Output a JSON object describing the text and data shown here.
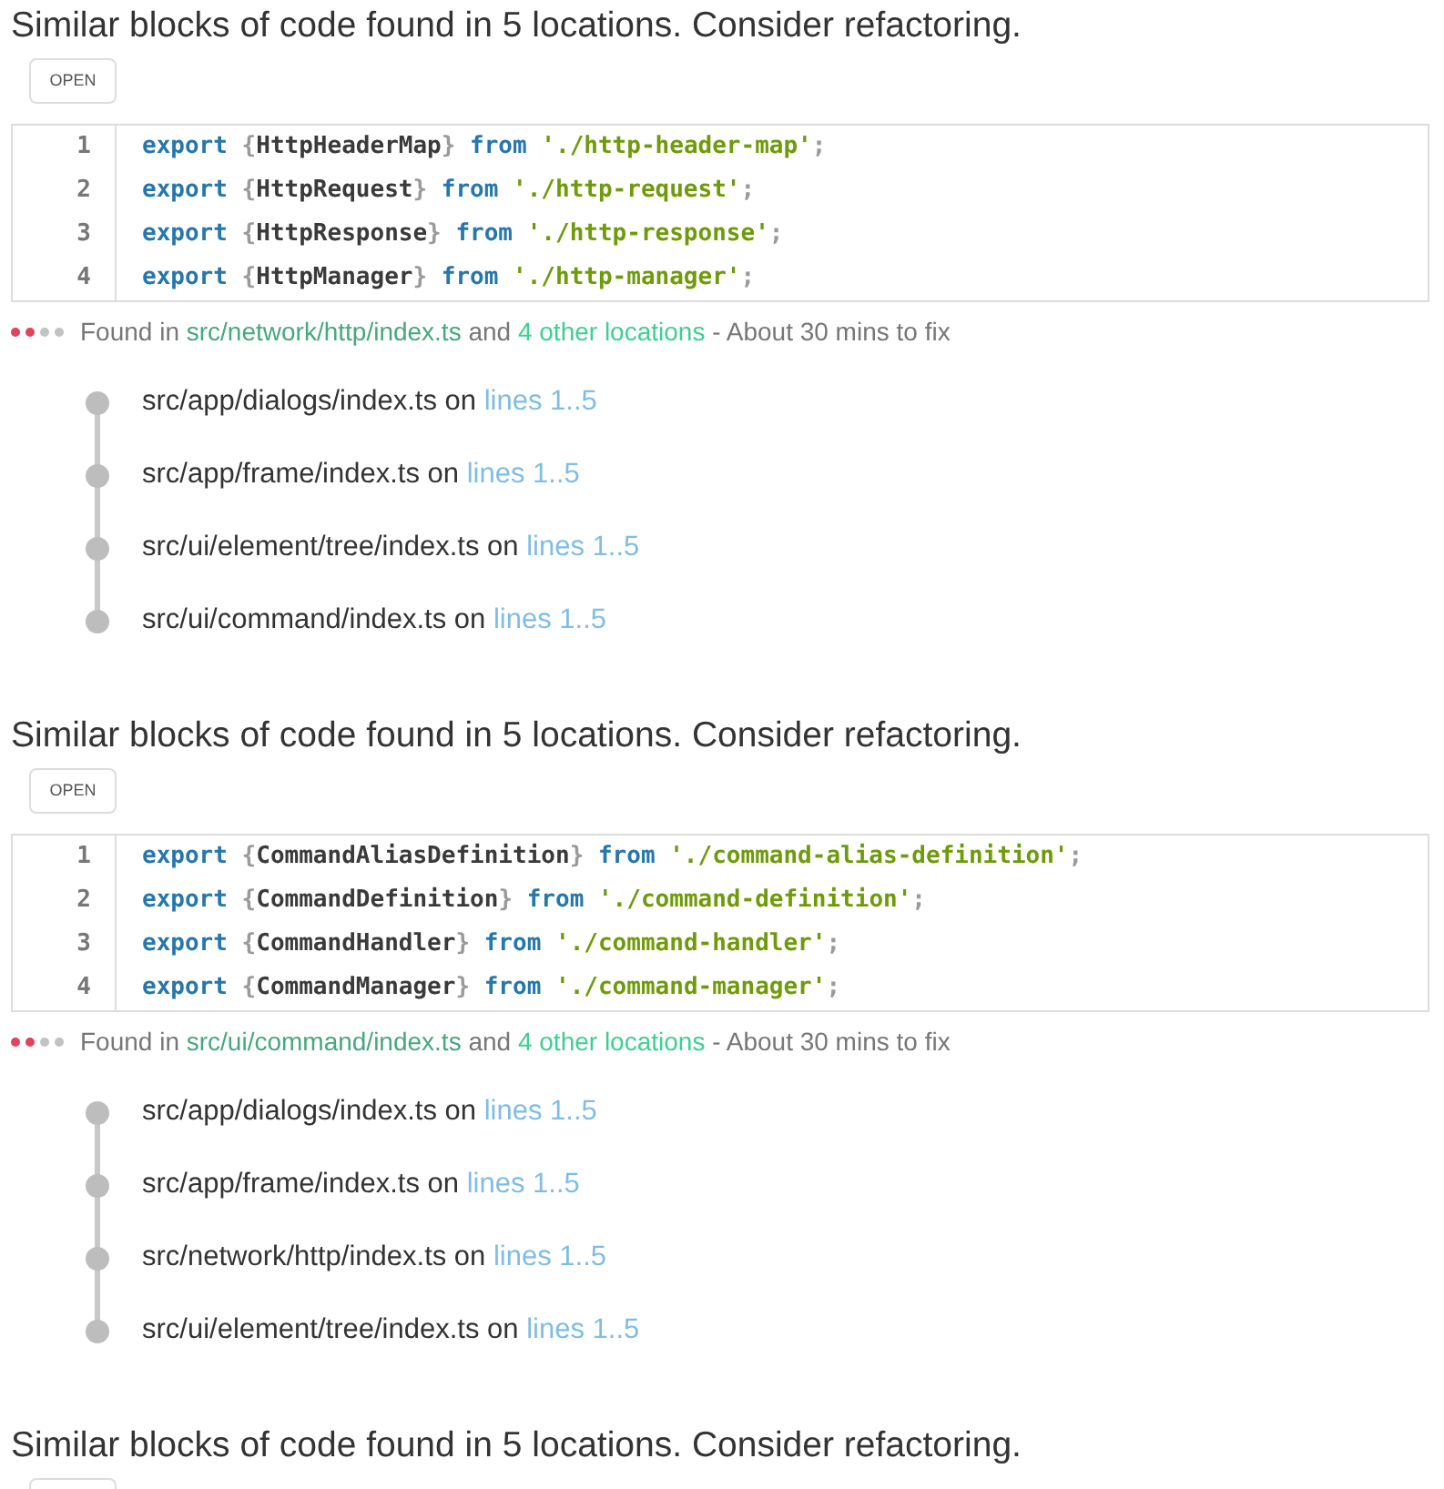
{
  "issues": [
    {
      "title": "Similar blocks of code found in 5 locations. Consider refactoring.",
      "open_button": {
        "label": "OPEN"
      },
      "code": [
        {
          "number": "1",
          "tokens": [
            {
              "kind": "keyword",
              "text": "export"
            },
            {
              "kind": "brace_open",
              "text": "{"
            },
            {
              "kind": "name",
              "text": "HttpHeaderMap"
            },
            {
              "kind": "brace_close",
              "text": "}"
            },
            {
              "kind": "keyword",
              "text": "from"
            },
            {
              "kind": "string",
              "text": "'./http-header-map'"
            },
            {
              "kind": "terminator",
              "text": ";"
            }
          ]
        },
        {
          "number": "2",
          "tokens": [
            {
              "kind": "keyword",
              "text": "export"
            },
            {
              "kind": "brace_open",
              "text": "{"
            },
            {
              "kind": "name",
              "text": "HttpRequest"
            },
            {
              "kind": "brace_close",
              "text": "}"
            },
            {
              "kind": "keyword",
              "text": "from"
            },
            {
              "kind": "string",
              "text": "'./http-request'"
            },
            {
              "kind": "terminator",
              "text": ";"
            }
          ]
        },
        {
          "number": "3",
          "tokens": [
            {
              "kind": "keyword",
              "text": "export"
            },
            {
              "kind": "brace_open",
              "text": "{"
            },
            {
              "kind": "name",
              "text": "HttpResponse"
            },
            {
              "kind": "brace_close",
              "text": "}"
            },
            {
              "kind": "keyword",
              "text": "from"
            },
            {
              "kind": "string",
              "text": "'./http-response'"
            },
            {
              "kind": "terminator",
              "text": ";"
            }
          ]
        },
        {
          "number": "4",
          "tokens": [
            {
              "kind": "keyword",
              "text": "export"
            },
            {
              "kind": "brace_open",
              "text": "{"
            },
            {
              "kind": "name",
              "text": "HttpManager"
            },
            {
              "kind": "brace_close",
              "text": "}"
            },
            {
              "kind": "keyword",
              "text": "from"
            },
            {
              "kind": "string",
              "text": "'./http-manager'"
            },
            {
              "kind": "terminator",
              "text": ";"
            }
          ]
        }
      ],
      "footer": {
        "stars": 2,
        "prefix": "Found in",
        "path": "src/network/http/index.ts",
        "joiner": "and",
        "others": "4 other locations",
        "suffix": "- About 30 mins to fix"
      },
      "locations": [
        {
          "path": "src/app/dialogs/index.ts",
          "joiner": "on",
          "lines": "lines 1..5"
        },
        {
          "path": "src/app/frame/index.ts",
          "joiner": "on",
          "lines": "lines 1..5"
        },
        {
          "path": "src/ui/element/tree/index.ts",
          "joiner": "on",
          "lines": "lines 1..5"
        },
        {
          "path": "src/ui/command/index.ts",
          "joiner": "on",
          "lines": "lines 1..5"
        }
      ]
    },
    {
      "title": "Similar blocks of code found in 5 locations. Consider refactoring.",
      "open_button": {
        "label": "OPEN"
      },
      "code": [
        {
          "number": "1",
          "tokens": [
            {
              "kind": "keyword",
              "text": "export"
            },
            {
              "kind": "brace_open",
              "text": "{"
            },
            {
              "kind": "name",
              "text": "CommandAliasDefinition"
            },
            {
              "kind": "brace_close",
              "text": "}"
            },
            {
              "kind": "keyword",
              "text": "from"
            },
            {
              "kind": "string",
              "text": "'./command-alias-definition'"
            },
            {
              "kind": "terminator",
              "text": ";"
            }
          ]
        },
        {
          "number": "2",
          "tokens": [
            {
              "kind": "keyword",
              "text": "export"
            },
            {
              "kind": "brace_open",
              "text": "{"
            },
            {
              "kind": "name",
              "text": "CommandDefinition"
            },
            {
              "kind": "brace_close",
              "text": "}"
            },
            {
              "kind": "keyword",
              "text": "from"
            },
            {
              "kind": "string",
              "text": "'./command-definition'"
            },
            {
              "kind": "terminator",
              "text": ";"
            }
          ]
        },
        {
          "number": "3",
          "tokens": [
            {
              "kind": "keyword",
              "text": "export"
            },
            {
              "kind": "brace_open",
              "text": "{"
            },
            {
              "kind": "name",
              "text": "CommandHandler"
            },
            {
              "kind": "brace_close",
              "text": "}"
            },
            {
              "kind": "keyword",
              "text": "from"
            },
            {
              "kind": "string",
              "text": "'./command-handler'"
            },
            {
              "kind": "terminator",
              "text": ";"
            }
          ]
        },
        {
          "number": "4",
          "tokens": [
            {
              "kind": "keyword",
              "text": "export"
            },
            {
              "kind": "brace_open",
              "text": "{"
            },
            {
              "kind": "name",
              "text": "CommandManager"
            },
            {
              "kind": "brace_close",
              "text": "}"
            },
            {
              "kind": "keyword",
              "text": "from"
            },
            {
              "kind": "string",
              "text": "'./command-manager'"
            },
            {
              "kind": "terminator",
              "text": ";"
            }
          ]
        }
      ],
      "footer": {
        "stars": 2,
        "prefix": "Found in",
        "path": "src/ui/command/index.ts",
        "joiner": "and",
        "others": "4 other locations",
        "suffix": "- About 30 mins to fix"
      },
      "locations": [
        {
          "path": "src/app/dialogs/index.ts",
          "joiner": "on",
          "lines": "lines 1..5"
        },
        {
          "path": "src/app/frame/index.ts",
          "joiner": "on",
          "lines": "lines 1..5"
        },
        {
          "path": "src/network/http/index.ts",
          "joiner": "on",
          "lines": "lines 1..5"
        },
        {
          "path": "src/ui/element/tree/index.ts",
          "joiner": "on",
          "lines": "lines 1..5"
        }
      ]
    },
    {
      "title": "Similar blocks of code found in 5 locations. Consider refactoring.",
      "open_button_stub": true
    }
  ]
}
